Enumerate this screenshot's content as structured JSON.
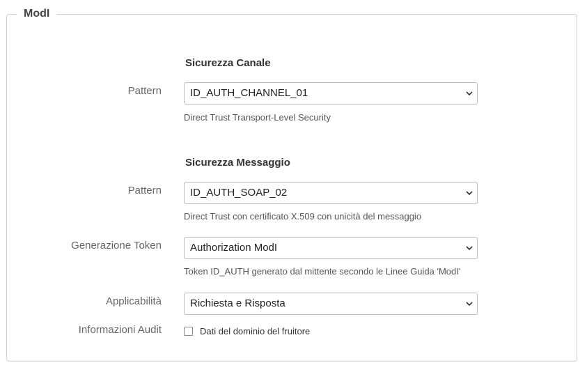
{
  "fieldset": {
    "legend": "ModI"
  },
  "channel_security": {
    "title": "Sicurezza Canale",
    "pattern_label": "Pattern",
    "pattern_value": "ID_AUTH_CHANNEL_01",
    "pattern_help": "Direct Trust Transport-Level Security"
  },
  "message_security": {
    "title": "Sicurezza Messaggio",
    "pattern_label": "Pattern",
    "pattern_value": "ID_AUTH_SOAP_02",
    "pattern_help": "Direct Trust con certificato X.509 con unicità del messaggio",
    "token_label": "Generazione Token",
    "token_value": "Authorization ModI",
    "token_help": "Token ID_AUTH generato dal mittente secondo le Linee Guida 'ModI'",
    "applicability_label": "Applicabilità",
    "applicability_value": "Richiesta e Risposta",
    "audit_label": "Informazioni Audit",
    "audit_checkbox_label": "Dati del dominio del fruitore",
    "audit_checked": false
  },
  "icons": {
    "select_arrow": "chevron-down-icon"
  }
}
